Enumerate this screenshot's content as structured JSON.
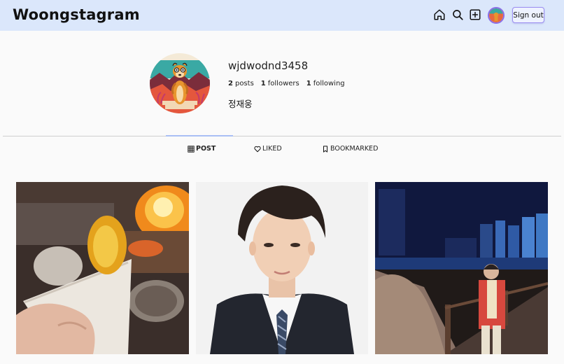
{
  "header": {
    "logo": "Woongstagram",
    "nav_icons": [
      "home-icon",
      "search-icon",
      "new-post-icon"
    ],
    "signout_label": "Sign out"
  },
  "profile": {
    "username": "wjdwodnd3458",
    "posts_count": "2",
    "posts_label": "posts",
    "followers_count": "1",
    "followers_label": "followers",
    "following_count": "1",
    "following_label": "following",
    "real_name": "정재웅"
  },
  "tabs": [
    {
      "label": "POST",
      "icon": "grid-icon",
      "active": true
    },
    {
      "label": "LIKED",
      "icon": "heart-icon",
      "active": false
    },
    {
      "label": "BOOKMARKED",
      "icon": "bookmark-icon",
      "active": false
    }
  ],
  "posts": [
    "campfire-sweet-potato-photo",
    "portrait-photo",
    "night-boardwalk-photo"
  ],
  "colors": {
    "header_bg": "#dbe7fb",
    "active_tab_line": "#a9bff5",
    "signout_border": "#9a8cf0"
  }
}
